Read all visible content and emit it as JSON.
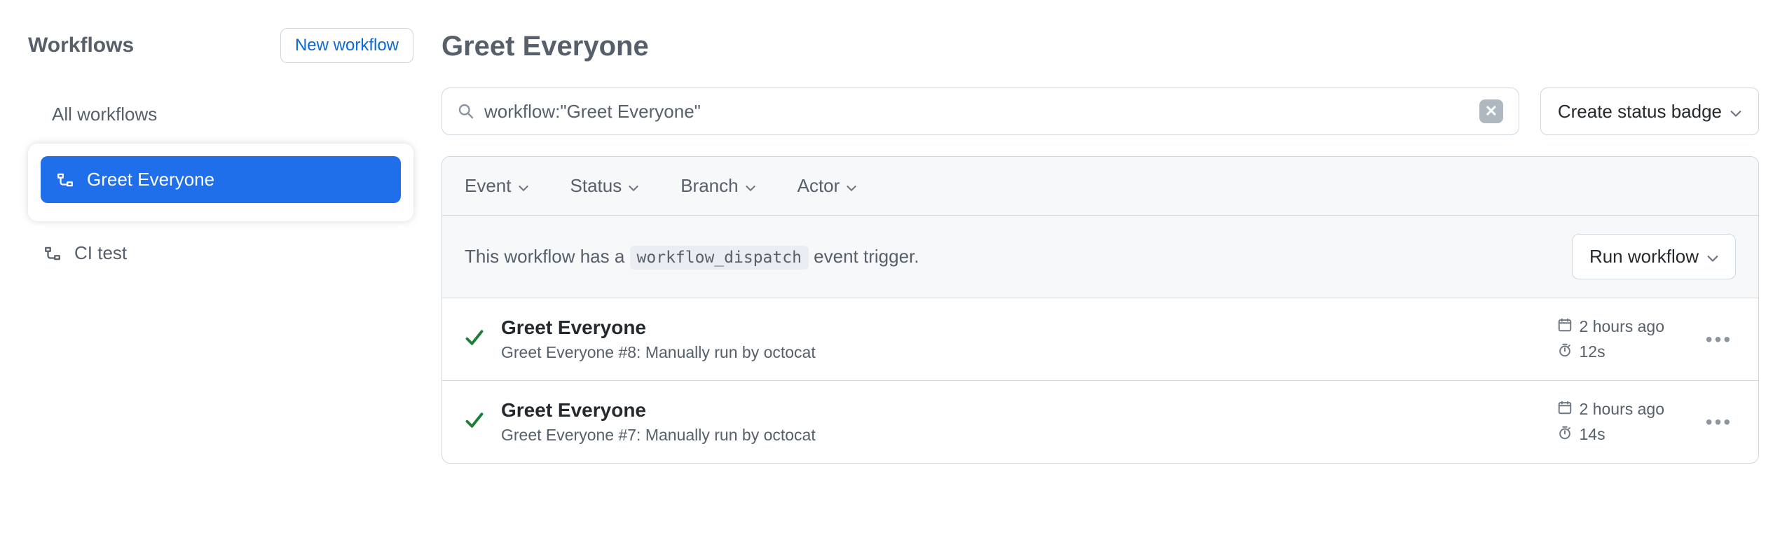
{
  "sidebar": {
    "title": "Workflows",
    "new_button": "New workflow",
    "all_label": "All workflows",
    "items": [
      {
        "label": "Greet Everyone",
        "active": true
      },
      {
        "label": "CI test",
        "active": false
      }
    ]
  },
  "page": {
    "title": "Greet Everyone"
  },
  "search": {
    "value": "workflow:\"Greet Everyone\""
  },
  "buttons": {
    "create_badge": "Create status badge",
    "run_workflow": "Run workflow"
  },
  "filters": {
    "event": "Event",
    "status": "Status",
    "branch": "Branch",
    "actor": "Actor"
  },
  "dispatch": {
    "prefix": "This workflow has a ",
    "code": "workflow_dispatch",
    "suffix": " event trigger."
  },
  "runs": [
    {
      "title": "Greet Everyone",
      "subtitle": "Greet Everyone #8: Manually run by octocat",
      "when": "2 hours ago",
      "duration": "12s"
    },
    {
      "title": "Greet Everyone",
      "subtitle": "Greet Everyone #7: Manually run by octocat",
      "when": "2 hours ago",
      "duration": "14s"
    }
  ]
}
